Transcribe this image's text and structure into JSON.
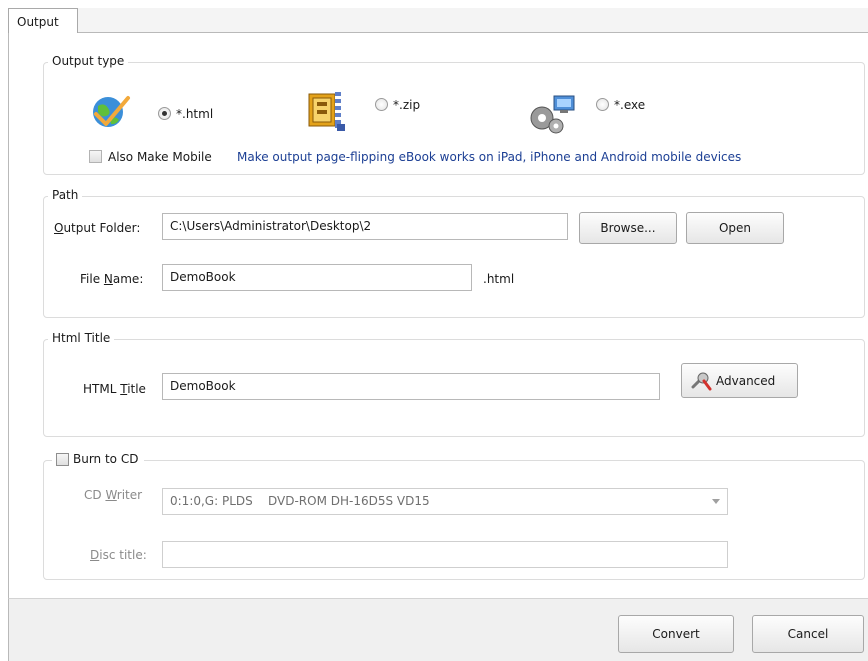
{
  "tab": {
    "label": "Output"
  },
  "output_type": {
    "label": "Output type",
    "options": [
      {
        "label": "*.html",
        "icon": "globe-check-icon",
        "selected": true
      },
      {
        "label": "*.zip",
        "icon": "zip-archive-icon",
        "selected": false
      },
      {
        "label": "*.exe",
        "icon": "gears-computer-icon",
        "selected": false
      }
    ],
    "mobile_checkbox": {
      "label": "Also Make Mobile",
      "checked": false
    },
    "mobile_note": "Make output page-flipping eBook works on iPad, iPhone and Android mobile devices"
  },
  "path": {
    "label": "Path",
    "output_folder_prefix": "O",
    "output_folder_rest": "utput Folder:",
    "output_folder_value": "C:\\Users\\Administrator\\Desktop\\2",
    "browse_label": "Browse...",
    "open_label": "Open",
    "file_name_prefix": "File ",
    "file_name_accel": "N",
    "file_name_rest": "ame:",
    "file_name_value": "DemoBook",
    "file_ext": ".html"
  },
  "html_title": {
    "label": "Html Title",
    "field_prefix": "HTML ",
    "field_accel": "T",
    "field_rest": "itle",
    "value": "DemoBook",
    "advanced_label": "Advanced"
  },
  "burn": {
    "label": "Burn to CD",
    "checked": false,
    "cd_writer_prefix": "CD ",
    "cd_writer_accel": "W",
    "cd_writer_rest": "riter",
    "cd_writer_value": "0:1:0,G: PLDS    DVD-ROM DH-16D5S VD15",
    "disc_title_accel": "D",
    "disc_title_rest": "isc title:",
    "disc_title_value": ""
  },
  "buttons": {
    "convert": "Convert",
    "cancel": "Cancel"
  },
  "colors": {
    "link_text": "#1c3f94",
    "disabled_text": "#8a8a8a"
  }
}
